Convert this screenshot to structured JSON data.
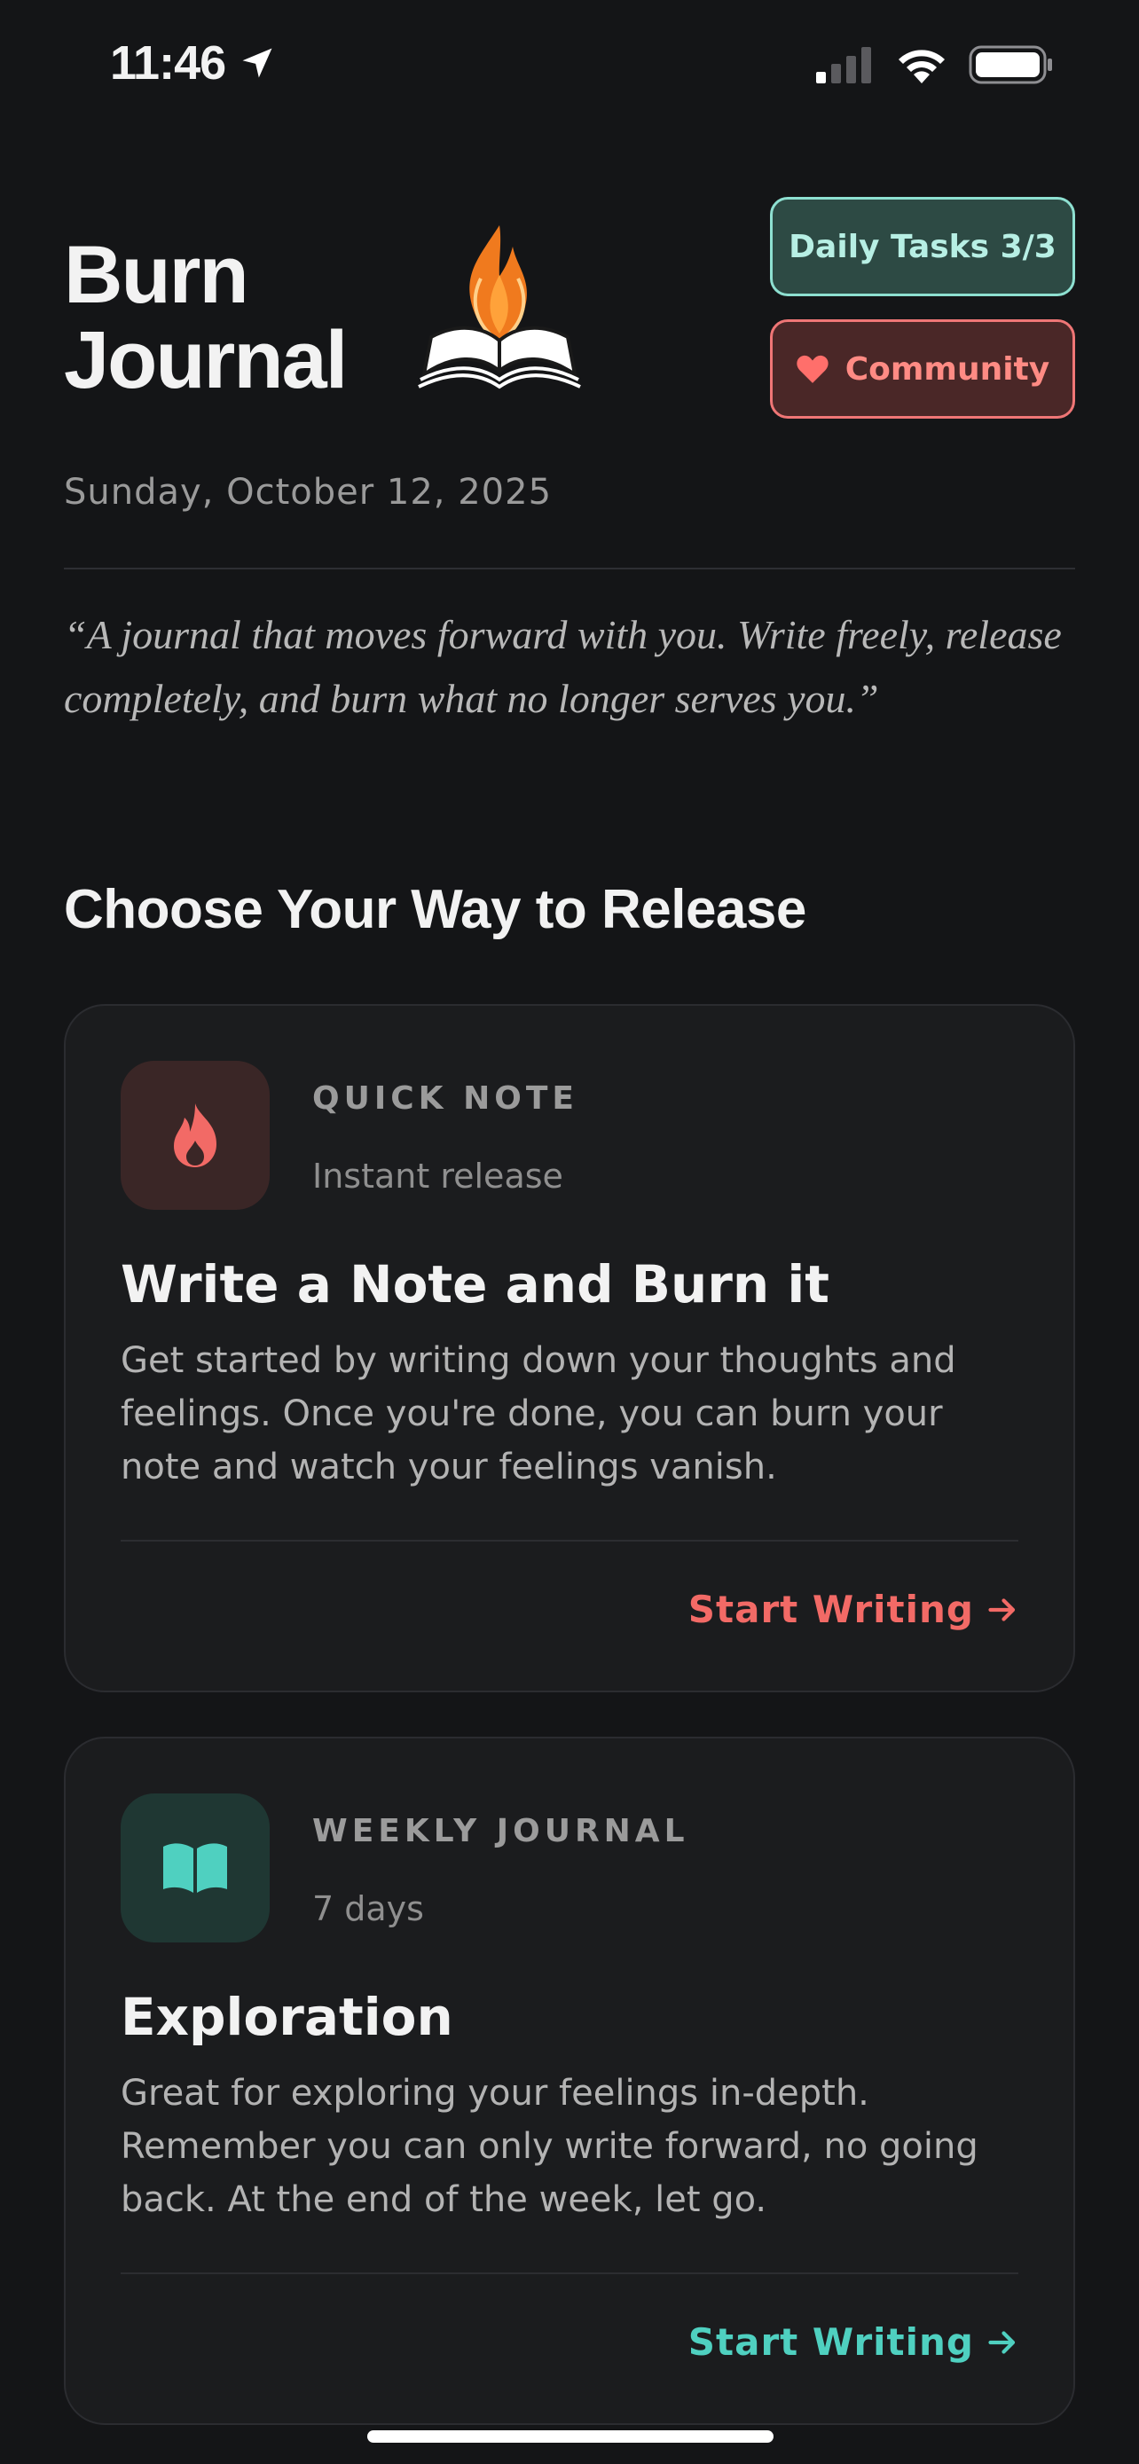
{
  "status_bar": {
    "time": "11:46",
    "icons": [
      "location-arrow-icon",
      "cellular-signal-icon",
      "wifi-icon",
      "battery-icon"
    ]
  },
  "header": {
    "title": "Burn Journal",
    "logo": "flaming-book-logo",
    "daily_tasks_label": "Daily Tasks 3/3",
    "community_label": "Community",
    "community_icon": "heart-icon",
    "date": "Sunday, October 12, 2025"
  },
  "quote": "“A journal that moves forward with you. Write freely, release completely, and burn what no longer serves you.”",
  "section_title": "Choose Your Way to Release",
  "cards": [
    {
      "kicker": "QUICK NOTE",
      "meta": "Instant release",
      "title": "Write a Note and Burn it",
      "description": "Get started by writing down your thoughts and feelings. Once you're done, you can burn your note and watch your feelings vanish.",
      "cta": "Start Writing",
      "icon": "flame-icon",
      "accent": "#f26a66"
    },
    {
      "kicker": "WEEKLY JOURNAL",
      "meta": "7 days",
      "title": "Exploration",
      "description": "Great for exploring your feelings in-depth. Remember you can only write forward, no going back. At the end of the week, let go.",
      "cta": "Start Writing",
      "icon": "open-book-icon",
      "accent": "#4fd0c0"
    }
  ],
  "colors": {
    "background": "#141517",
    "card": "#1b1c1e",
    "tasks_border": "#8ee0d1",
    "community_border": "#ef7676"
  }
}
